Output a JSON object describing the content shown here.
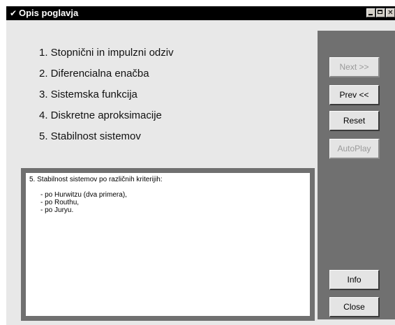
{
  "window": {
    "title": "Opis poglavja",
    "icon": "check-icon"
  },
  "menu": {
    "items": [
      "1. Stopnični in impulzni odziv",
      "2. Diferencialna enačba",
      "3. Sistemska funkcija",
      "4. Diskretne aproksimacije",
      "5. Stabilnost sistemov"
    ]
  },
  "description": {
    "heading": "5. Stabilnost sistemov po različnih kriterijih:",
    "lines": [
      "- po Hurwitzu (dva primera),",
      "- po Routhu,",
      "- po Juryu."
    ]
  },
  "buttons": {
    "next": "Next >>",
    "prev": "Prev <<",
    "reset": "Reset",
    "autoplay": "AutoPlay",
    "info": "Info",
    "close": "Close"
  },
  "colors": {
    "titlebar": "#000000",
    "panel": "#707070",
    "window_bg": "#e8e8e8"
  }
}
